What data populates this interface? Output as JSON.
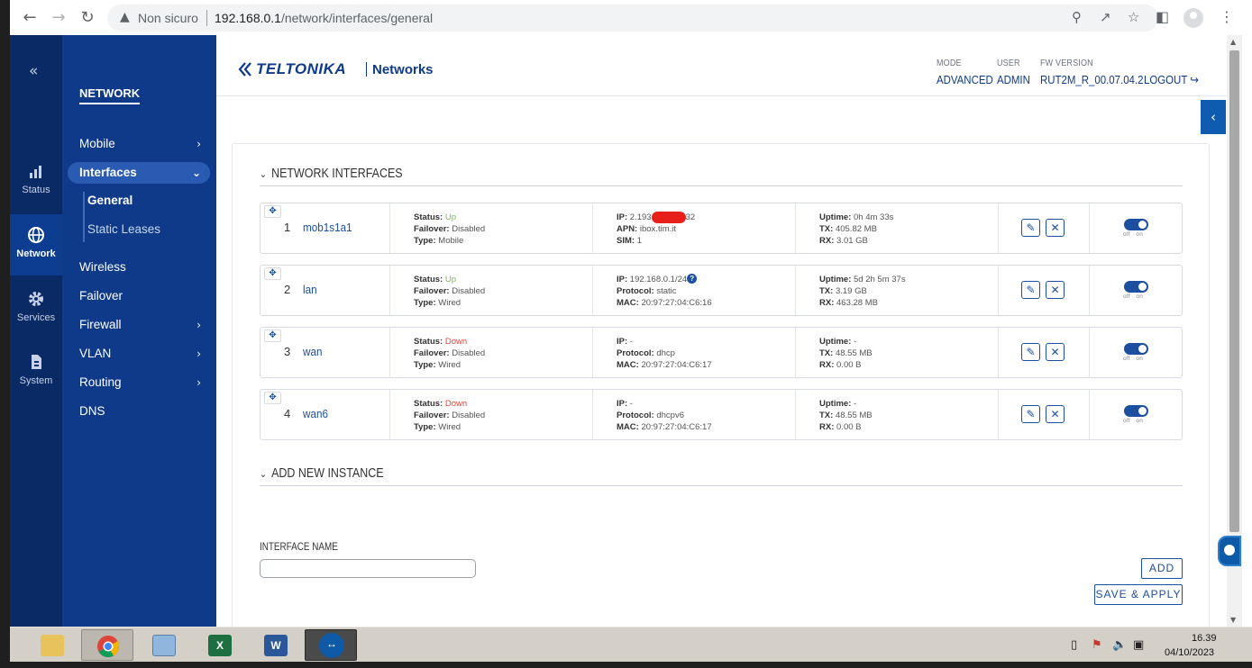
{
  "browser": {
    "not_secure": "Non sicuro",
    "url_host": "192.168.0.1",
    "url_path": "/network/interfaces/general"
  },
  "rail": {
    "items": [
      {
        "label": "Status",
        "icon": "bar-chart-icon"
      },
      {
        "label": "Network",
        "icon": "globe-icon"
      },
      {
        "label": "Services",
        "icon": "gear-icon"
      },
      {
        "label": "System",
        "icon": "document-icon"
      }
    ]
  },
  "menu": {
    "title": "NETWORK",
    "items": [
      "Mobile",
      "Interfaces",
      "Wireless",
      "Failover",
      "Firewall",
      "VLAN",
      "Routing",
      "DNS"
    ],
    "submenu": [
      "General",
      "Static Leases"
    ]
  },
  "header": {
    "brand": "TELTONIKA",
    "brand_sub": "Networks",
    "mode_label": "MODE",
    "mode_value": "ADVANCED",
    "user_label": "USER",
    "user_value": "ADMIN",
    "fw_label": "FW VERSION",
    "fw_value": "RUT2M_R_00.07.04.2",
    "logout": "LOGOUT"
  },
  "section": {
    "interfaces_title": "NETWORK INTERFACES",
    "add_title": "ADD NEW INSTANCE",
    "interface_name_label": "INTERFACE NAME",
    "add_button": "ADD",
    "save_button": "SAVE & APPLY"
  },
  "labels": {
    "status": "Status:",
    "failover": "Failover:",
    "type": "Type:",
    "ip": "IP:",
    "apn": "APN:",
    "sim": "SIM:",
    "protocol": "Protocol:",
    "mac": "MAC:",
    "uptime": "Uptime:",
    "tx": "TX:",
    "rx": "RX:",
    "toggle_off": "off",
    "toggle_on": "on"
  },
  "interfaces": [
    {
      "num": "1",
      "name": "mob1s1a1",
      "status": "Up",
      "failover": "Disabled",
      "type": "Mobile",
      "ip_prefix": "2.193",
      "ip_suffix": "32",
      "apn": "ibox.tim.it",
      "sim": "1",
      "uptime": "0h 4m 33s",
      "tx": "405.82 MB",
      "rx": "3.01 GB",
      "enabled": true
    },
    {
      "num": "2",
      "name": "lan",
      "status": "Up",
      "failover": "Disabled",
      "type": "Wired",
      "ip": "192.168.0.1/24",
      "protocol": "static",
      "mac": "20:97:27:04:C6:16",
      "uptime": "5d 2h 5m 37s",
      "tx": "3.19 GB",
      "rx": "463.28 MB",
      "enabled": true
    },
    {
      "num": "3",
      "name": "wan",
      "status": "Down",
      "failover": "Disabled",
      "type": "Wired",
      "ip": "-",
      "protocol": "dhcp",
      "mac": "20:97:27:04:C6:17",
      "uptime": "-",
      "tx": "48.55 MB",
      "rx": "0.00 B",
      "enabled": true
    },
    {
      "num": "4",
      "name": "wan6",
      "status": "Down",
      "failover": "Disabled",
      "type": "Wired",
      "ip": "-",
      "protocol": "dhcpv6",
      "mac": "20:97:27:04:C6:17",
      "uptime": "-",
      "tx": "48.55 MB",
      "rx": "0.00 B",
      "enabled": true
    }
  ],
  "taskbar": {
    "apps": [
      "file-explorer",
      "chrome",
      "calculator",
      "excel",
      "word",
      "teamviewer"
    ],
    "time": "16.39",
    "date": "04/10/2023"
  },
  "colors": {
    "rail": "#0a2a66",
    "menu": "#0f3a8a",
    "accent": "#1c4fa0",
    "up": "#7ab85c",
    "down": "#e0453a"
  }
}
